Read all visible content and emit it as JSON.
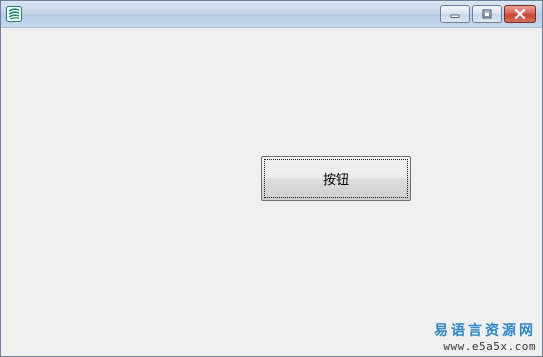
{
  "window": {
    "title": "",
    "icon": "app-icon"
  },
  "titlebar": {
    "controls": {
      "minimize_icon": "minimize-icon",
      "maximize_icon": "maximize-icon",
      "close_icon": "close-icon"
    }
  },
  "content": {
    "button_label": "按钮"
  },
  "watermark": {
    "site_name": "易语言资源网",
    "url": "www.e5a5x.com"
  },
  "colors": {
    "close_button": "#c54330",
    "watermark_text": "#2f86c4",
    "client_background": "#f0f0f0"
  }
}
